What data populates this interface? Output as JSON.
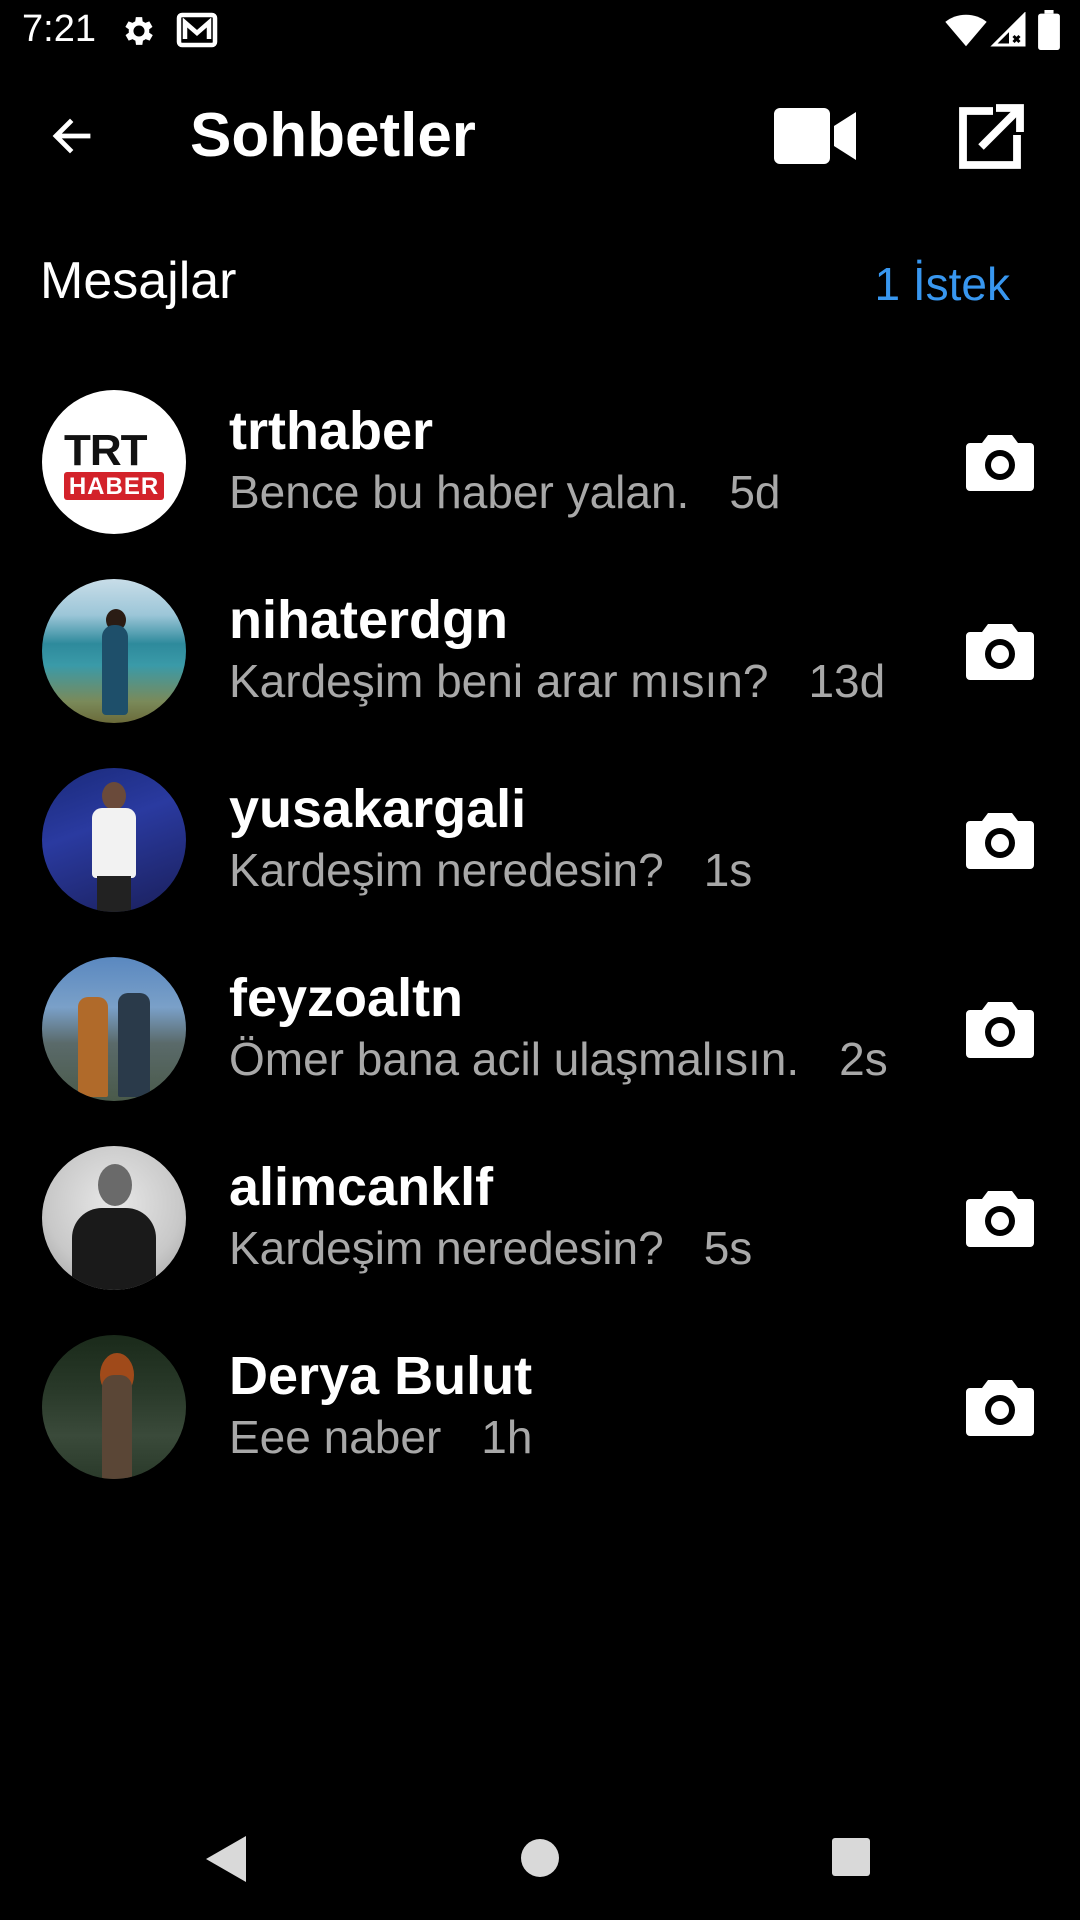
{
  "status_bar": {
    "time": "7:21"
  },
  "app_bar": {
    "title": "Sohbetler"
  },
  "section": {
    "title": "Mesajlar",
    "requests_label": "1 İstek"
  },
  "conversations": [
    {
      "name": "trthaber",
      "preview": "Bence bu haber yalan.",
      "time": "5d"
    },
    {
      "name": "nihaterdgn",
      "preview": "Kardeşim beni arar mısın?",
      "time": "13d"
    },
    {
      "name": "yusakargali",
      "preview": "Kardeşim neredesin?",
      "time": "1s"
    },
    {
      "name": "feyzoaltn",
      "preview": "Ömer bana acil ulaşmalısın.",
      "time": "2s"
    },
    {
      "name": "alimcanklf",
      "preview": "Kardeşim neredesin?",
      "time": "5s"
    },
    {
      "name": "Derya Bulut",
      "preview": "Eee naber",
      "time": "1h"
    }
  ],
  "avatar_logo": {
    "trt": "TRT",
    "haber": "HABER"
  },
  "colors": {
    "background": "#000000",
    "text_primary": "#ffffff",
    "text_secondary": "#a8a8a8",
    "accent": "#3897f0",
    "trt_red": "#d3222a"
  },
  "icons": {
    "status": [
      "gear-icon",
      "mail-icon",
      "wifi-icon",
      "signal-icon",
      "battery-icon"
    ],
    "app_bar": [
      "back-arrow-icon",
      "video-camera-icon",
      "compose-icon"
    ],
    "row_action": "camera-icon",
    "nav": [
      "nav-back-icon",
      "nav-home-icon",
      "nav-recents-icon"
    ]
  }
}
